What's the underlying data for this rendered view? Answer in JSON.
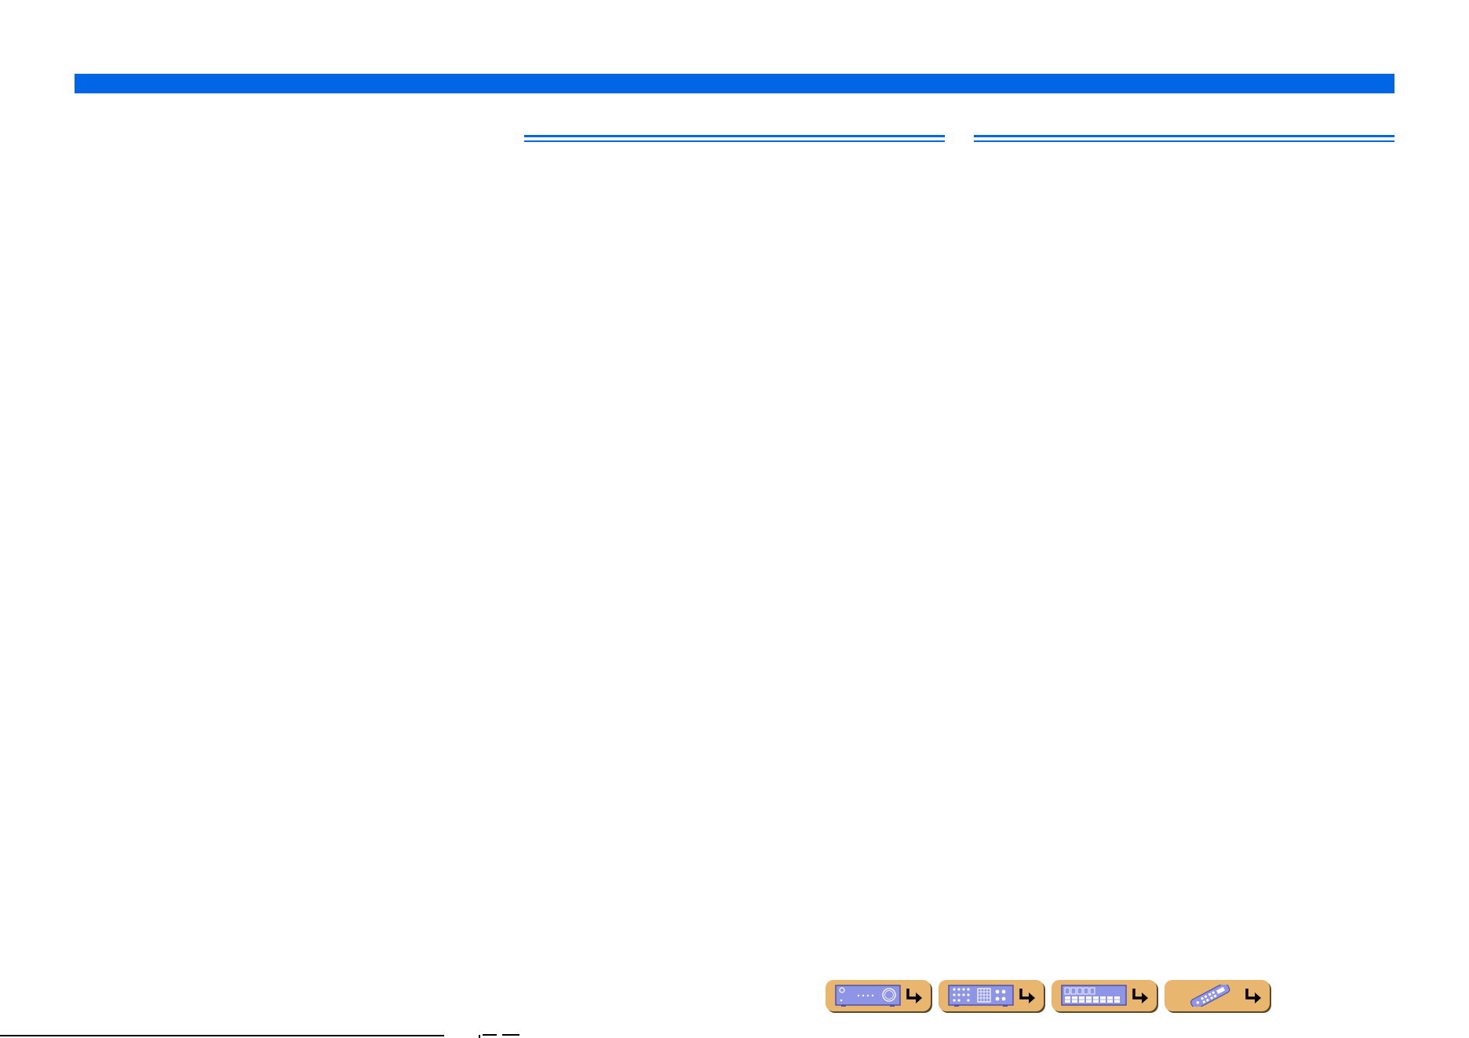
{
  "header": {
    "bar_color": "#0066e6"
  },
  "columns": {
    "left_rule_color": "#0066e6",
    "right_rule_color": "#0066e6"
  },
  "nav_buttons": [
    {
      "name": "front-panel",
      "icon": "front-panel-icon"
    },
    {
      "name": "rear-panel",
      "icon": "rear-panel-icon"
    },
    {
      "name": "front-display",
      "icon": "front-display-icon"
    },
    {
      "name": "remote-control",
      "icon": "remote-control-icon"
    }
  ],
  "colors": {
    "nav_button_bg": "#e8b66e",
    "nav_panel": "#8f95e6"
  }
}
